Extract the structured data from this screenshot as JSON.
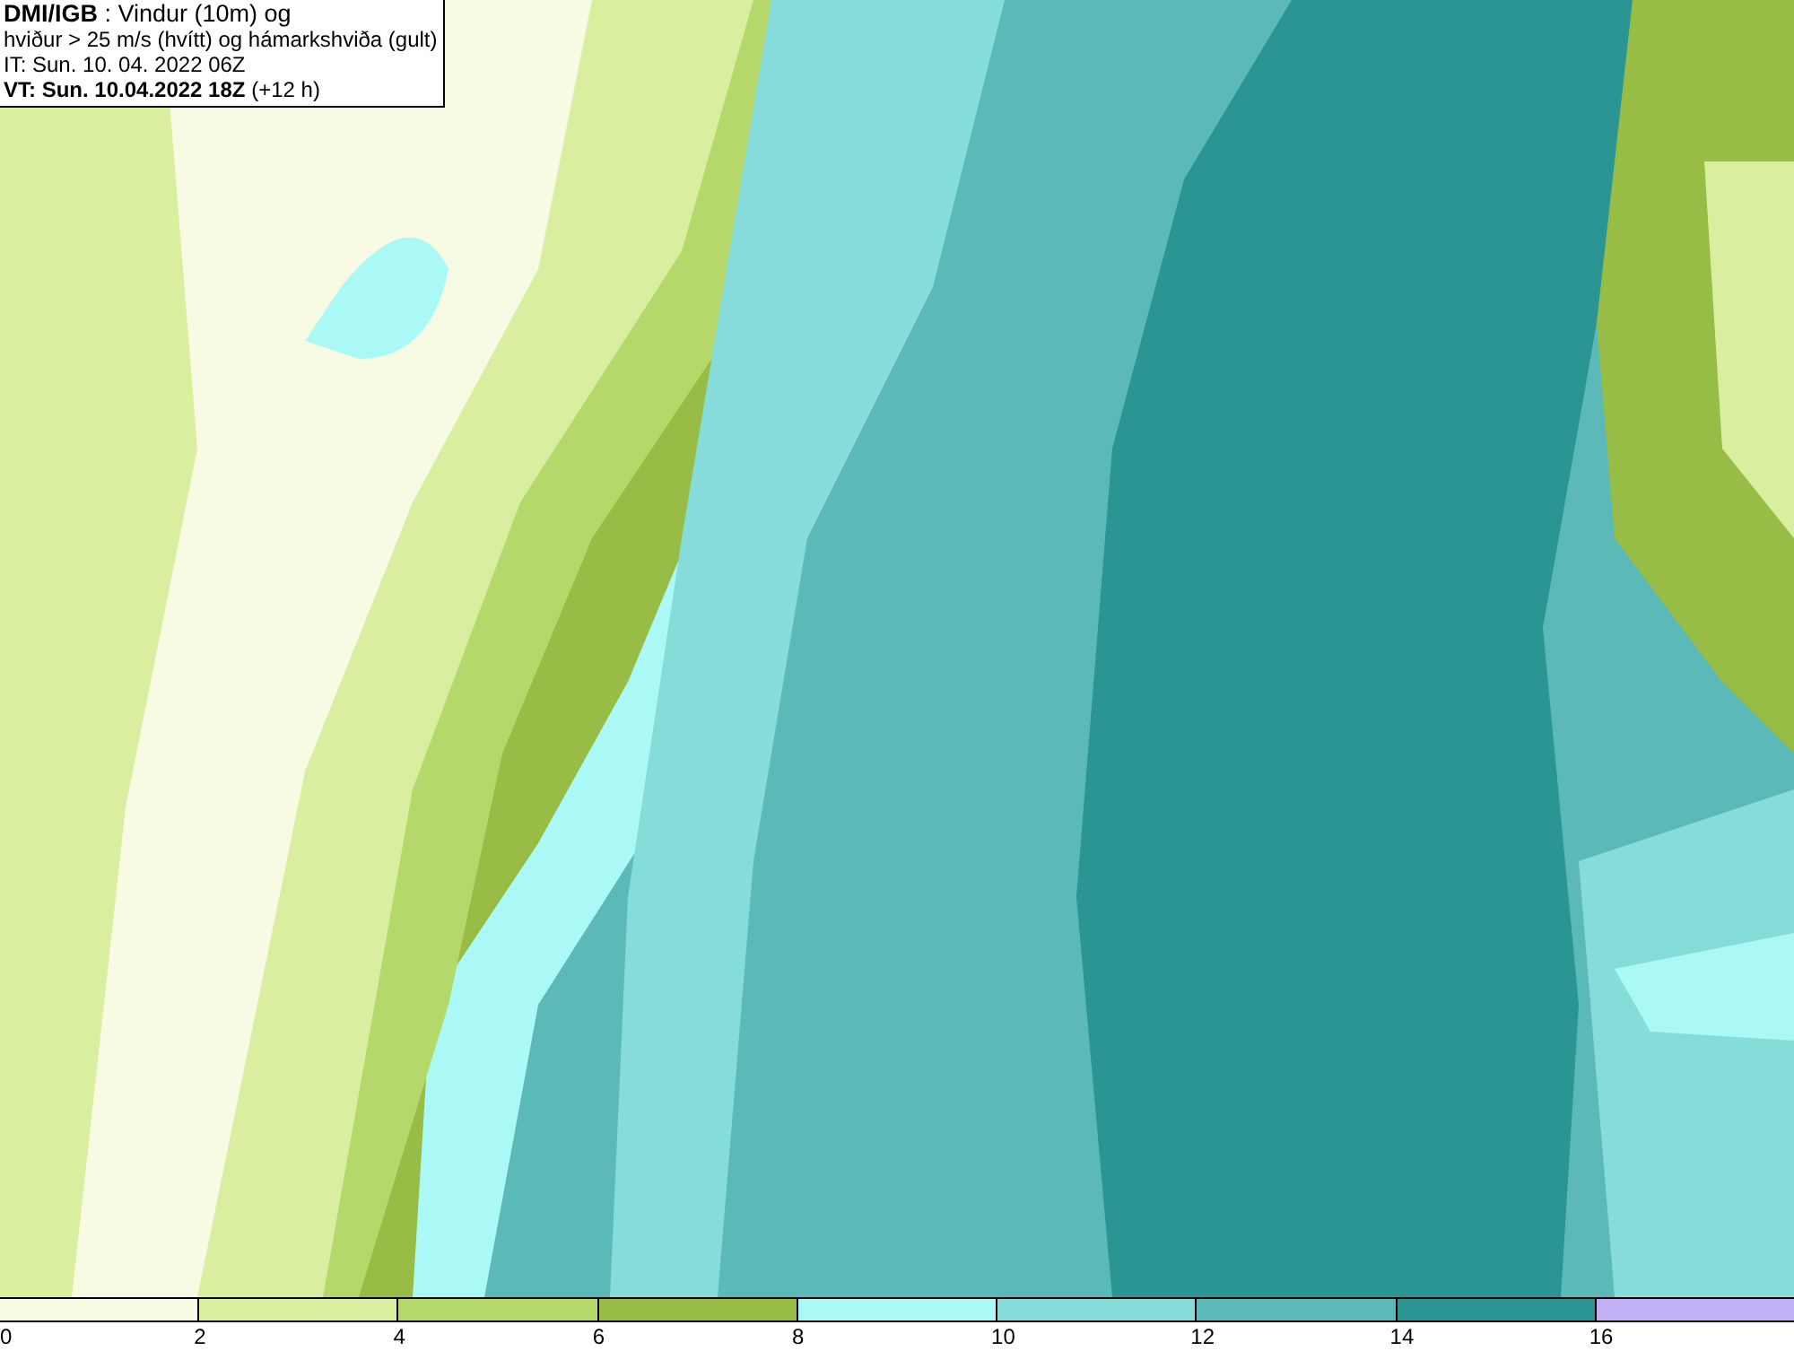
{
  "header": {
    "lines": [
      "**DMI/IGB** : Vindur (10m) og",
      "hviður > 25 m/s (hvítt) og hámarkshviða (gult)",
      "IT: Sun. 10. 04. 2022 06Z",
      "**VT: Sun. 10.04.2022 18Z** (+12 h)"
    ]
  },
  "legend": {
    "bins": [
      {
        "color": "#f7fbe3"
      },
      {
        "color": "#d9ee9f"
      },
      {
        "color": "#b5d86a"
      },
      {
        "color": "#97bd46"
      },
      {
        "color": "#aaf9f7"
      },
      {
        "color": "#86dcd9"
      },
      {
        "color": "#5bbab8"
      },
      {
        "color": "#2a9593"
      },
      {
        "color": "#c2b0f5"
      }
    ],
    "ticks": [
      "0",
      "2",
      "4",
      "6",
      "8",
      "10",
      "12",
      "14",
      "16"
    ]
  }
}
